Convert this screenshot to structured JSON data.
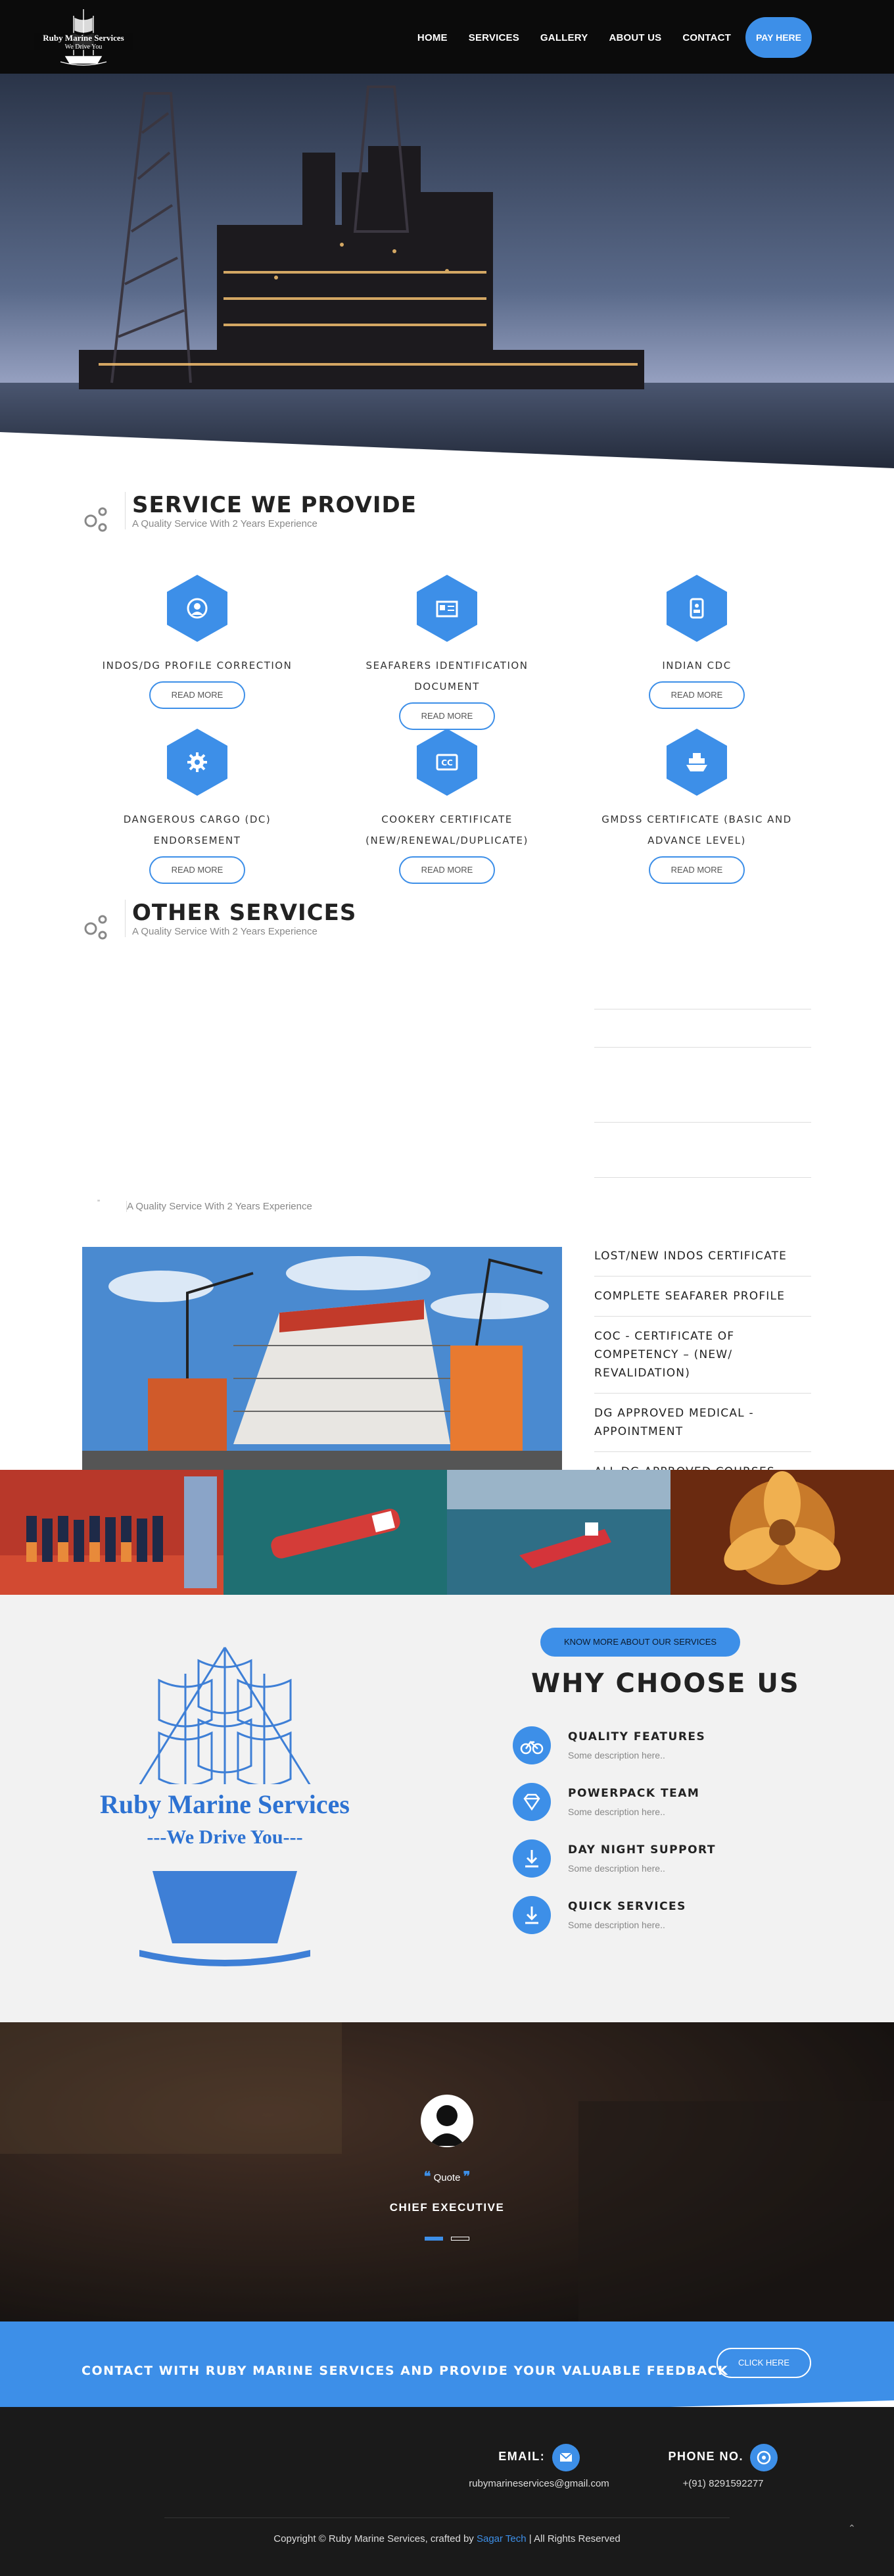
{
  "header": {
    "logo": {
      "title": "Ruby Marine Services",
      "tagline": "We Drive You"
    },
    "nav": [
      "HOME",
      "SERVICES",
      "GALLERY",
      "ABOUT US",
      "CONTACT"
    ],
    "pay_button": "PAY HERE"
  },
  "services_section": {
    "title": "SERVICE WE PROVIDE",
    "subtitle": "A Quality Service With 2 Years Experience",
    "items": [
      {
        "title": "INDOS/DG PROFILE CORRECTION",
        "icon": "user-icon",
        "button": "READ MORE"
      },
      {
        "title": "SEAFARERS IDENTIFICATION DOCUMENT",
        "icon": "id-card-icon",
        "button": "READ MORE"
      },
      {
        "title": "INDIAN CDC",
        "icon": "badge-icon",
        "button": "READ MORE"
      },
      {
        "title": "DANGEROUS CARGO (DC) ENDORSEMENT",
        "icon": "gear-icon",
        "button": "READ MORE"
      },
      {
        "title": "COOKERY CERTIFICATE (NEW/RENEWAL/DUPLICATE)",
        "icon": "cc-icon",
        "button": "READ MORE"
      },
      {
        "title": "GMDSS CERTIFICATE (BASIC AND ADVANCE LEVEL)",
        "icon": "ship-icon",
        "button": "READ MORE"
      }
    ]
  },
  "other_section": {
    "title": "OTHER SERVICES",
    "subtitle": "A Quality Service With 2 Years Experience",
    "second_subtitle": "A Quality Service With 2 Years Experience",
    "list": [
      "LOST/NEW INDOS CERTIFICATE",
      "COMPLETE SEAFARER PROFILE",
      "COC - CERTIFICATE OF COMPETENCY – (NEW/ REVALIDATION)",
      "DG APPROVED MEDICAL - APPOINTMENT",
      "ALL DG APPROVED COURSES"
    ]
  },
  "why": {
    "know_button": "KNOW MORE ABOUT OUR SERVICES",
    "title": "WHY CHOOSE US",
    "logo_title": "Ruby Marine Services",
    "logo_tagline": "---We Drive You---",
    "features": [
      {
        "title": "QUALITY FEATURES",
        "desc": "Some description here..",
        "icon": "bicycle-icon"
      },
      {
        "title": "POWERPACK TEAM",
        "desc": "Some description here..",
        "icon": "diamond-icon"
      },
      {
        "title": "DAY NIGHT SUPPORT",
        "desc": "Some description here..",
        "icon": "download-icon"
      },
      {
        "title": "QUICK SERVICES",
        "desc": "Some description here..",
        "icon": "download-icon"
      }
    ]
  },
  "testimonial": {
    "quote": "Quote",
    "name": "CHIEF EXECUTIVE"
  },
  "contact_band": {
    "text": "CONTACT WITH RUBY MARINE SERVICES AND PROVIDE YOUR VALUABLE FEEDBACK",
    "button": "CLICK HERE"
  },
  "footer": {
    "email_label": "EMAIL:",
    "email": "rubymarineservices@gmail.com",
    "phone_label": "PHONE NO.",
    "phone": "+(91) 8291592277",
    "copy_pre": "Copyright © Ruby Marine Services, crafted by ",
    "copy_link": "Sagar Tech",
    "copy_post": " | All Rights Reserved"
  },
  "colors": {
    "accent": "#3d8fe8",
    "dark": "#0b0b0b",
    "footer": "#1a1a1a"
  }
}
